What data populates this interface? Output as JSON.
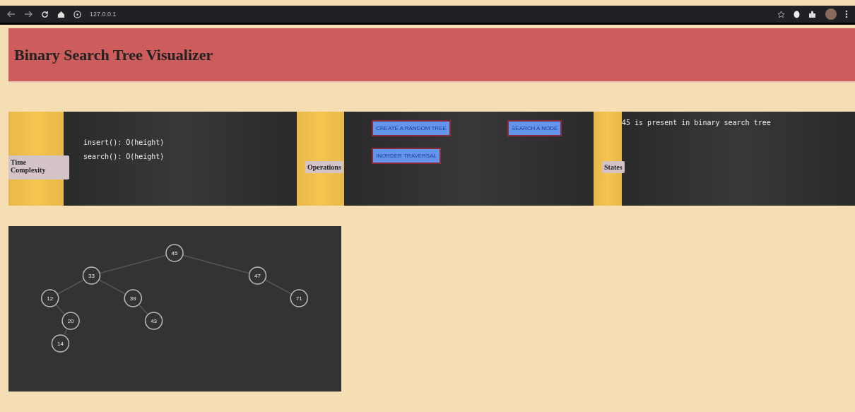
{
  "browser": {
    "url": "127.0.0.1"
  },
  "header": {
    "title": "Binary Search Tree Visualizer"
  },
  "sections": [
    {
      "kind": "complexity",
      "label": "Time Complexity",
      "lines": [
        "insert(): O(height)",
        "search(): O(height)"
      ]
    },
    {
      "kind": "operations",
      "label": "Operations",
      "buttons": [
        "CREATE A RANDOM TREE",
        "SEARCH A NODE",
        "INORDER TRAVERSAL"
      ]
    },
    {
      "kind": "status",
      "label": "States",
      "message": "45 is present in binary search tree"
    }
  ],
  "tree": {
    "value": "45",
    "left": {
      "value": "33",
      "left": {
        "value": "12",
        "right": {
          "value": "20",
          "left": {
            "value": "14"
          }
        }
      },
      "right": {
        "value": "39",
        "right": {
          "value": "43"
        }
      }
    },
    "right": {
      "value": "47",
      "right": {
        "value": "71"
      }
    }
  }
}
